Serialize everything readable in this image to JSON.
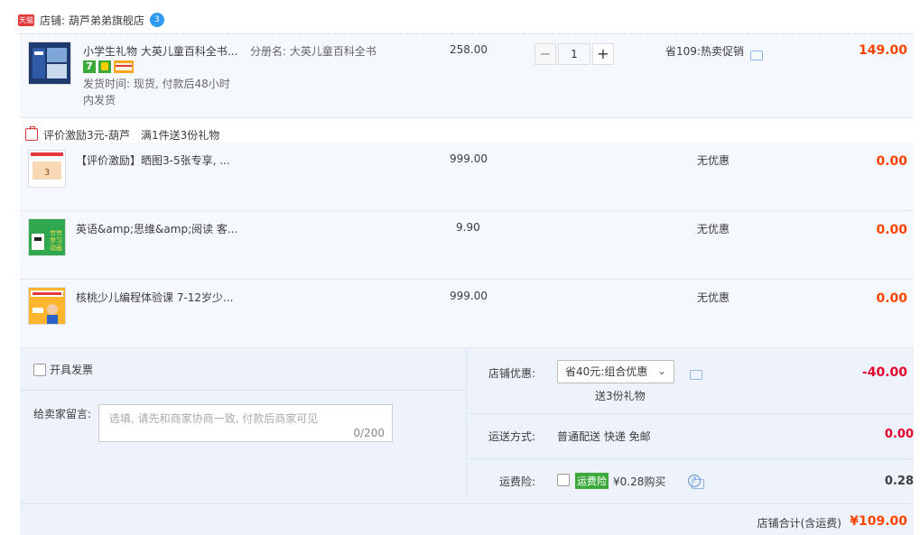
{
  "shop": {
    "logo_text": "天猫",
    "label": "店铺: 葫芦弟弟旗舰店",
    "ww_text": "3"
  },
  "main_item": {
    "title": "小学生礼物 大英儿童百科全书...",
    "sku": "分册名: 大英儿童百科全书",
    "tag1": "7",
    "ship_time_1": "发货时间: 现货, 付款后48小时",
    "ship_time_2": "内发货",
    "price": "258.00",
    "quantity": "1",
    "minus": "−",
    "plus": "+",
    "promo": "省109:热卖促销",
    "amount": "149.00"
  },
  "gift_header": {
    "label1": "评价激励3元-葫芦",
    "label2": "满1件送3份礼物"
  },
  "gifts": [
    {
      "title": "【评价激励】晒图3-5张专享, ...",
      "price": "999.00",
      "discount": "无优惠",
      "amount": "0.00",
      "thumb_text": "3"
    },
    {
      "title": "英语&amp;思维&amp;阅读 客...",
      "price": "9.90",
      "discount": "无优惠",
      "amount": "0.00",
      "thumb_text": "节节学习动画"
    },
    {
      "title": "核桃少儿编程体验课 7-12岁少...",
      "price": "999.00",
      "discount": "无优惠",
      "amount": "0.00",
      "thumb_text": "少儿编程"
    }
  ],
  "invoice": {
    "label": "开具发票"
  },
  "message": {
    "label": "给卖家留言:",
    "placeholder": "选填, 请先和商家协商一致, 付款后商家可见",
    "count": "0/200"
  },
  "shop_discount": {
    "label": "店铺优惠:",
    "selected": "省40元:组合优惠",
    "gift_note": "送3份礼物",
    "amount": "-40.00"
  },
  "shipping": {
    "label": "运送方式:",
    "method": "普通配送 快递 免邮",
    "amount": "0.00"
  },
  "insurance": {
    "label": "运费险:",
    "tag": "运费险",
    "price": "¥0.28购买",
    "amount": "0.28"
  },
  "total": {
    "label": "店铺合计(含运费)",
    "amount": "¥109.00"
  },
  "colors": {
    "accent": "#ff4400",
    "row_bg": "#f5f8fd",
    "panel_bg": "#eef3fb",
    "discount_red": "#e4002b"
  }
}
